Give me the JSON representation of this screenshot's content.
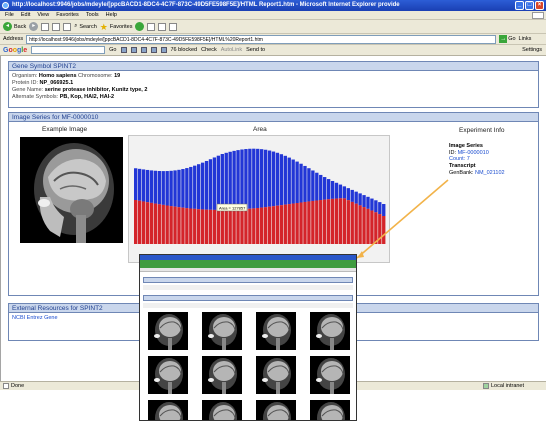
{
  "window": {
    "title": "http://localhost:9946/jobs/mdeyle/[ppcBACD1-8DC4-4C7F-873C-49D5FE598F5E]/HTML Report1.htm - Microsoft Internet Explorer provide"
  },
  "menu": [
    "File",
    "Edit",
    "View",
    "Favorites",
    "Tools",
    "Help"
  ],
  "toolbar": {
    "back": "Back",
    "search": "Search",
    "favorites": "Favorites"
  },
  "address": {
    "label": "Address",
    "url": "http://localhost:9946/jobs/mdeyle/[ppcBACD1-8DC4-4C7F-873C-49D5FE598F5E]/HTML%20Report1.htm",
    "go": "Go",
    "links": "Links"
  },
  "googlebar": {
    "logo_parts": [
      "G",
      "o",
      "o",
      "g",
      "l",
      "e"
    ],
    "go": "Go",
    "blocked": "76 blocked",
    "check": "Check",
    "autolink": "AutoLink",
    "send": "Send to",
    "settings": "Settings"
  },
  "gene_panel": {
    "title": "Gene Symbol SPINT2",
    "rows": [
      {
        "label": "Organism:",
        "value": "Homo sapiens",
        "label2": "Chromosome:",
        "value2": "19"
      },
      {
        "label": "Protein ID:",
        "value": "NP_066925.1"
      },
      {
        "label": "Gene Name:",
        "value": "serine protease inhibitor, Kunitz type, 2"
      },
      {
        "label": "Alternate Symbols:",
        "value": "PB, Kop, HAI2, HAI-2"
      }
    ]
  },
  "image_panel": {
    "title": "Image Series for MF-0000010",
    "example_image_title": "Example Image",
    "area_title": "Area",
    "chart_tooltip": "Area = 127857",
    "experiment": {
      "title": "Experiment Info",
      "image_series_label": "Image Series",
      "id_label": "ID:",
      "id_value": "MF-0000010",
      "count_label": "Count:",
      "count_value": "7",
      "transcript_label": "Transcript",
      "genbank_label": "GenBank:",
      "genbank_value": "NM_021102"
    }
  },
  "external_panel": {
    "title": "External Resources for SPINT2",
    "link": "NCBI Entrez Gene"
  },
  "status": {
    "left": "Done",
    "zone": "Local intranet"
  },
  "colors": {
    "panel_head": "#c9d6ec",
    "bar_blue": "#2236d6",
    "bar_red": "#d4242a",
    "callout": "#f2b34a"
  }
}
